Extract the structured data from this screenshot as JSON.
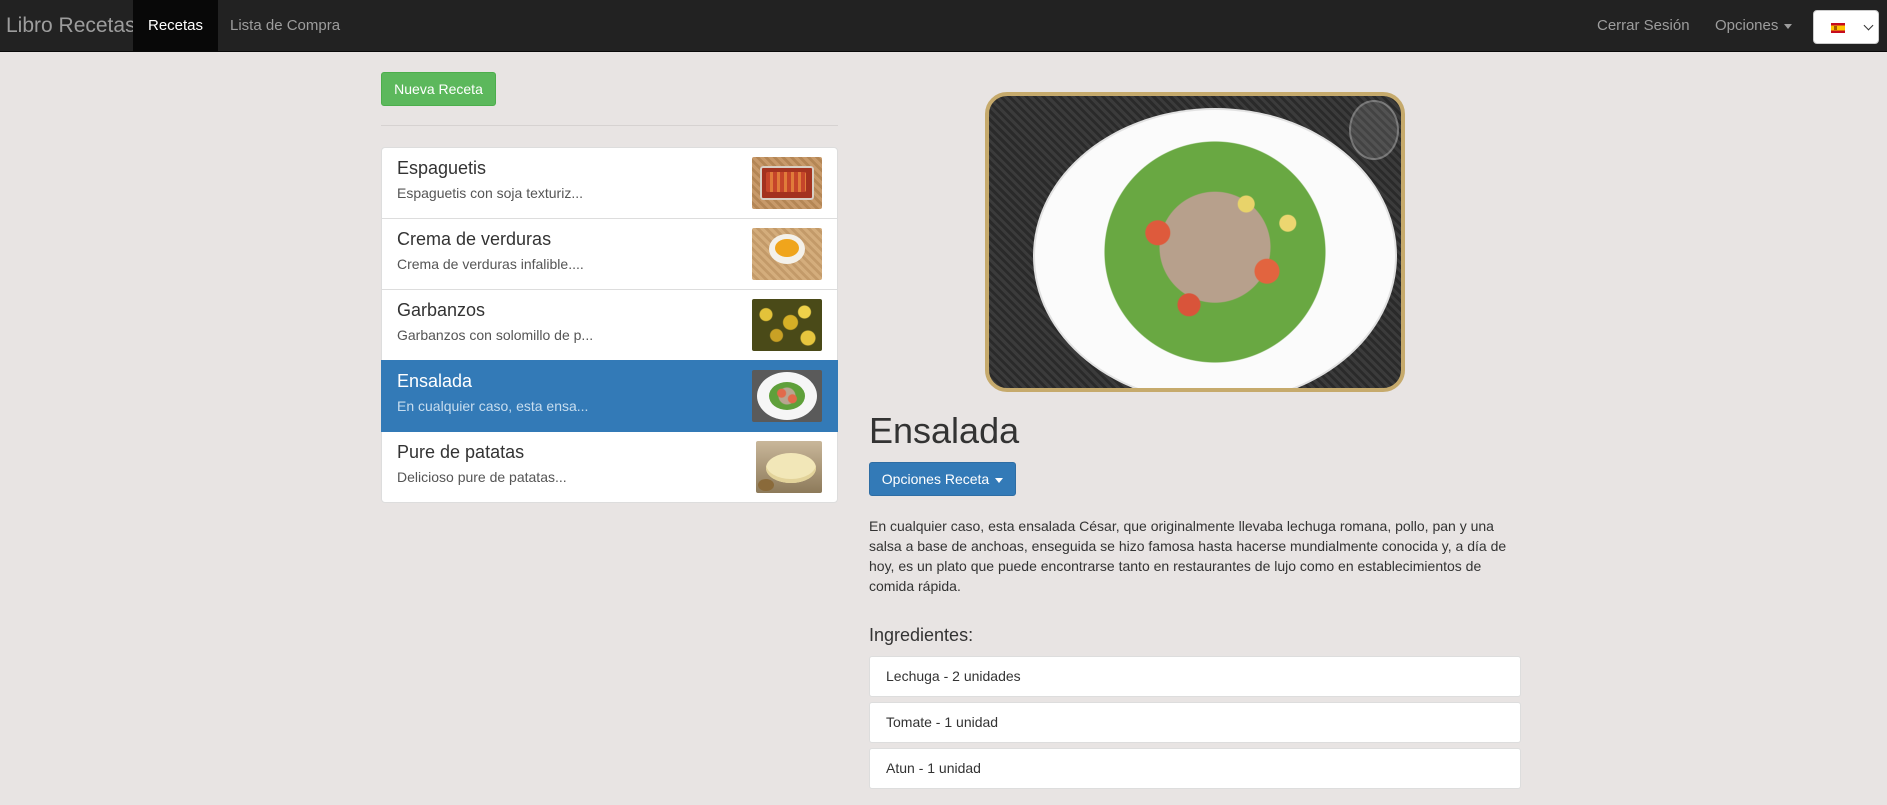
{
  "navbar": {
    "brand": "Libro Recetas",
    "links": [
      {
        "label": "Recetas",
        "active": true
      },
      {
        "label": "Lista de Compra",
        "active": false
      }
    ],
    "logout": "Cerrar Sesión",
    "options": "Opciones",
    "language": {
      "icon": "spain-flag-icon",
      "selected": "es"
    }
  },
  "sidebar": {
    "new_button": "Nueva Receta",
    "recipes": [
      {
        "title": "Espaguetis",
        "desc": "Espaguetis con soja texturiz...",
        "thumb": "spaghetti-thumbnail",
        "active": false
      },
      {
        "title": "Crema de verduras",
        "desc": "Crema de verduras infalible....",
        "thumb": "cream-soup-thumbnail",
        "active": false
      },
      {
        "title": "Garbanzos",
        "desc": "Garbanzos con solomillo de p...",
        "thumb": "chickpeas-thumbnail",
        "active": false
      },
      {
        "title": "Ensalada",
        "desc": "En cualquier caso, esta ensa...",
        "thumb": "salad-thumbnail",
        "active": true
      },
      {
        "title": "Pure de patatas",
        "desc": "Delicioso pure de patatas...",
        "thumb": "mashed-potatoes-thumbnail",
        "active": false
      }
    ]
  },
  "detail": {
    "title": "Ensalada",
    "options_button": "Opciones Receta",
    "description": "En cualquier caso, esta ensalada César, que originalmente llevaba lechuga romana, pollo, pan y una salsa a base de anchoas, enseguida se hizo famosa hasta hacerse mundialmente conocida y, a día de hoy, es un plato que puede encontrarse tanto en restaurantes de lujo como en establecimientos de comida rápida.",
    "ingredients_title": "Ingredientes:",
    "ingredients": [
      "Lechuga - 2 unidades",
      "Tomate - 1 unidad",
      "Atun - 1 unidad"
    ]
  },
  "colors": {
    "navbar_bg": "#222222",
    "success": "#5cb85c",
    "primary": "#337ab7",
    "page_bg": "#e8e4e3",
    "image_border": "#c6aa6c"
  }
}
